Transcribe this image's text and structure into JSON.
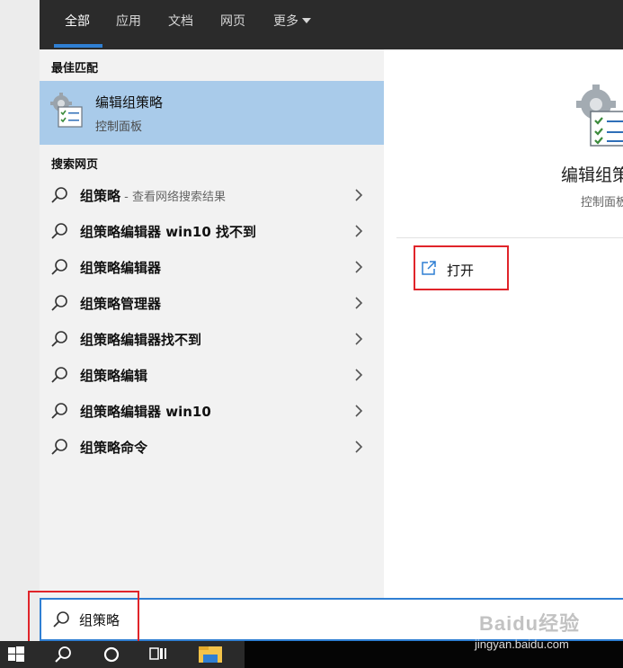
{
  "tabs": [
    {
      "label": "全部",
      "active": true
    },
    {
      "label": "应用",
      "active": false
    },
    {
      "label": "文档",
      "active": false
    },
    {
      "label": "网页",
      "active": false
    },
    {
      "label": "更多",
      "active": false
    }
  ],
  "best_match": {
    "section_title": "最佳匹配",
    "title": "编辑组策略",
    "subtitle": "控制面板",
    "icon": "group-policy-icon"
  },
  "web": {
    "section_title": "搜索网页",
    "items": [
      {
        "label": "组策略",
        "hint": " - 查看网络搜索结果"
      },
      {
        "label": "组策略编辑器 win10 找不到",
        "hint": ""
      },
      {
        "label": "组策略编辑器",
        "hint": ""
      },
      {
        "label": "组策略管理器",
        "hint": ""
      },
      {
        "label": "组策略编辑器找不到",
        "hint": ""
      },
      {
        "label": "组策略编辑",
        "hint": ""
      },
      {
        "label": "组策略编辑器 win10",
        "hint": ""
      },
      {
        "label": "组策略命令",
        "hint": ""
      }
    ]
  },
  "preview": {
    "title": "编辑组策略",
    "subtitle": "控制面板",
    "open_label": "打开"
  },
  "search": {
    "query": "组策略"
  },
  "watermark": {
    "logo": "Baidu经验",
    "url": "jingyan.baidu.com"
  },
  "colors": {
    "accent": "#2f7fd3",
    "selection": "#a9cbea",
    "highlight_box": "#e0242a",
    "tabbar": "#2b2b2b"
  }
}
